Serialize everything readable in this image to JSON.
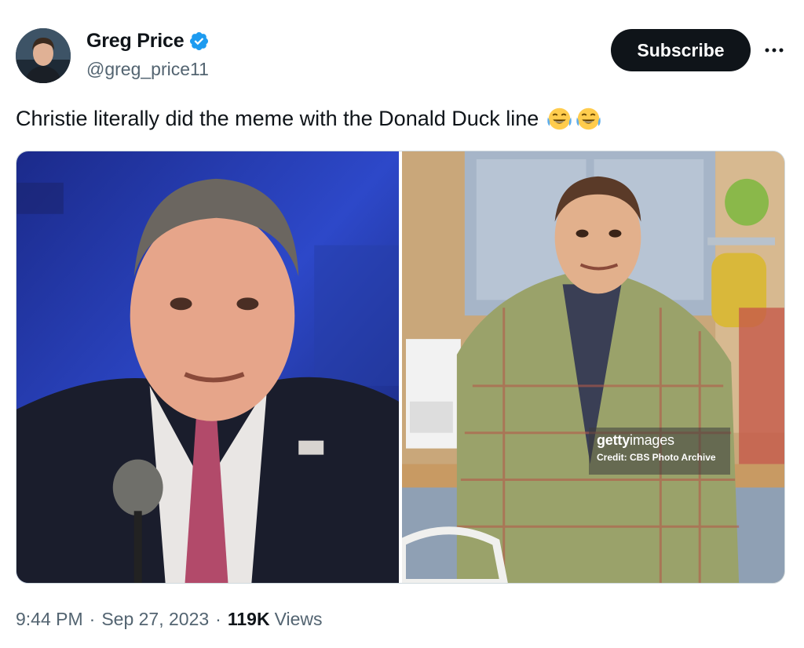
{
  "author": {
    "display_name": "Greg Price",
    "handle": "@greg_price11",
    "verified": true,
    "avatar_icon": "profile-photo"
  },
  "actions": {
    "subscribe_label": "Subscribe",
    "more_icon": "ellipsis-icon"
  },
  "tweet": {
    "text": "Christie literally did the meme with the Donald Duck line",
    "emojis": [
      "face-with-tears-of-joy",
      "face-with-tears-of-joy"
    ]
  },
  "media": {
    "images": [
      {
        "subject": "man-at-podium-photo"
      },
      {
        "subject": "man-in-kitchen-photo",
        "watermark": {
          "brand_bold": "getty",
          "brand_light": "images",
          "credit": "Credit: CBS Photo Archive"
        }
      }
    ]
  },
  "meta": {
    "time": "9:44 PM",
    "date": "Sep 27, 2023",
    "separator": "·",
    "views_count": "119K",
    "views_label": "Views"
  },
  "colors": {
    "text_primary": "#0f1419",
    "text_secondary": "#536471",
    "verified_blue": "#1d9bf0",
    "button_bg": "#0f1419"
  }
}
